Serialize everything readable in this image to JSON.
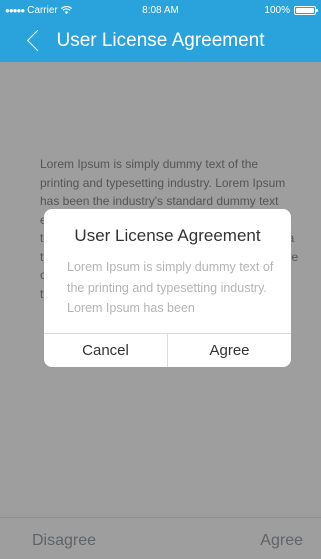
{
  "status_bar": {
    "carrier": "Carrier",
    "time": "8:08 AM",
    "battery": "100%"
  },
  "nav": {
    "title": "User License Agreement"
  },
  "content": {
    "text": "Lorem Ipsum is simply dummy text of the printing and typesetting industry. Lorem Ipsum has been the industry's standard dummy text ever since the 1500s, when an unknown printer took a galley of type and scrambled it to make a type specimen book. It has survived not only five centuries, but also the leap into electronic typesetting."
  },
  "bottom_bar": {
    "disagree_label": "Disagree",
    "agree_label": "Agree"
  },
  "dialog": {
    "title": "User License Agreement",
    "body": "Lorem Ipsum is simply dummy text of the printing and typesetting industry. Lorem Ipsum has been",
    "cancel_label": "Cancel",
    "agree_label": "Agree"
  }
}
